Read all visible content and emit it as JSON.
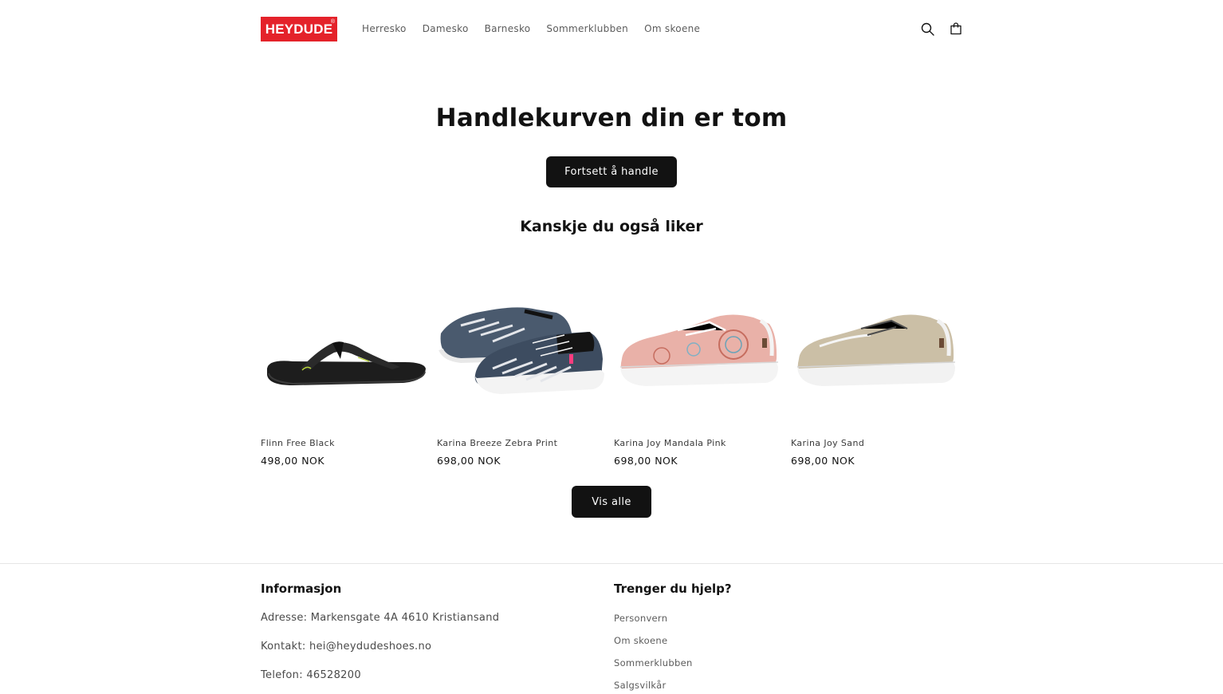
{
  "brand": {
    "logo_text": "HEYDUDE",
    "logo_mark": "®",
    "color": "#e4222a"
  },
  "nav": {
    "items": [
      "Herresko",
      "Damesko",
      "Barnesko",
      "Sommerklubben",
      "Om skoene"
    ]
  },
  "header_icons": {
    "search": "search-icon",
    "cart": "cart-icon"
  },
  "cart": {
    "title": "Handlekurven din er tom",
    "continue_label": "Fortsett å handle"
  },
  "recommendations": {
    "title": "Kanskje du også liker",
    "products": [
      {
        "name": "Flinn Free Black",
        "price": "498,00 NOK"
      },
      {
        "name": "Karina Breeze Zebra Print",
        "price": "698,00 NOK"
      },
      {
        "name": "Karina Joy Mandala Pink",
        "price": "698,00 NOK"
      },
      {
        "name": "Karina Joy Sand",
        "price": "698,00 NOK"
      }
    ],
    "view_all_label": "Vis alle"
  },
  "footer": {
    "info": {
      "title": "Informasjon",
      "address": "Adresse: Markensgate 4A 4610 Kristiansand",
      "contact": "Kontakt: hei@heydudeshoes.no",
      "phone": "Telefon: 46528200"
    },
    "help": {
      "title": "Trenger du hjelp?",
      "links": [
        "Personvern",
        "Om skoene",
        "Sommerklubben",
        "Salgsvilkår"
      ]
    }
  }
}
